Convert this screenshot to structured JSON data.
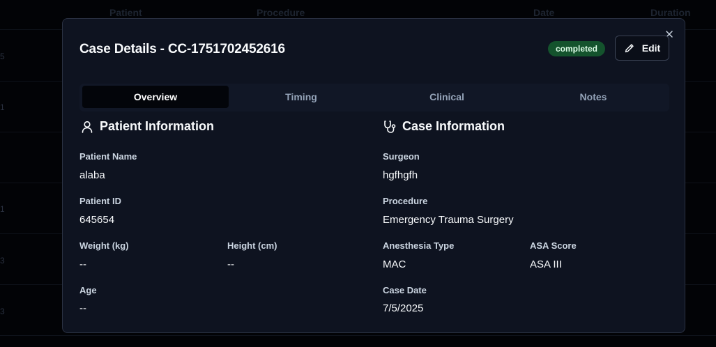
{
  "background_table": {
    "headers": [
      "Patient",
      "Procedure",
      "Date",
      "Duration"
    ],
    "row_fragments": [
      "5",
      "1",
      "1",
      "3",
      "3"
    ]
  },
  "modal": {
    "title": "Case Details - CC-1751702452616",
    "status": "completed",
    "edit_label": "Edit",
    "tabs": [
      {
        "label": "Overview",
        "active": true
      },
      {
        "label": "Timing",
        "active": false
      },
      {
        "label": "Clinical",
        "active": false
      },
      {
        "label": "Notes",
        "active": false
      }
    ],
    "patient_info": {
      "heading": "Patient Information",
      "icon": "user-icon",
      "name_label": "Patient Name",
      "name_value": "alaba",
      "id_label": "Patient ID",
      "id_value": "645654",
      "weight_label": "Weight (kg)",
      "weight_value": "--",
      "height_label": "Height (cm)",
      "height_value": "--",
      "age_label": "Age",
      "age_value": "--"
    },
    "case_info": {
      "heading": "Case Information",
      "icon": "stethoscope-icon",
      "surgeon_label": "Surgeon",
      "surgeon_value": "hgfhgfh",
      "procedure_label": "Procedure",
      "procedure_value": "Emergency Trauma Surgery",
      "anesthesia_label": "Anesthesia Type",
      "anesthesia_value": "MAC",
      "asa_label": "ASA Score",
      "asa_value": "ASA III",
      "date_label": "Case Date",
      "date_value": "7/5/2025"
    }
  },
  "colors": {
    "modal_bg": "#0e1320",
    "badge_bg": "#14532d",
    "badge_text": "#dcfce7",
    "accent_text": "#f8fafc",
    "muted_text": "#94a3b8"
  }
}
